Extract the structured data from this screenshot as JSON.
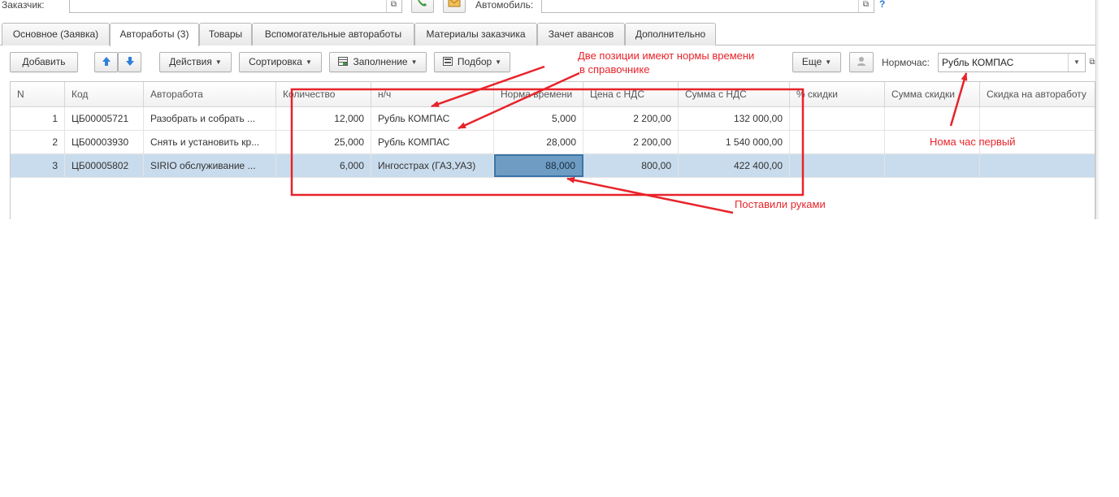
{
  "header": {
    "customer_label": "Заказчик:",
    "customer_value": "",
    "car_label": "Автомобиль:",
    "car_value": "",
    "open_icon": "open-external-icon",
    "phone_icon": "phone-icon",
    "mail_icon": "mail-icon",
    "help_label": "?"
  },
  "tabs": [
    {
      "label": "Основное (Заявка)"
    },
    {
      "label": "Автоработы (3)",
      "active": true
    },
    {
      "label": "Товары"
    },
    {
      "label": "Вспомогательные автоработы"
    },
    {
      "label": "Материалы заказчика"
    },
    {
      "label": "Зачет авансов"
    },
    {
      "label": "Дополнительно"
    }
  ],
  "toolbar": {
    "add_label": "Добавить",
    "up_icon": "arrow-up-icon",
    "down_icon": "arrow-down-icon",
    "actions_label": "Действия",
    "sort_label": "Сортировка",
    "fill_label": "Заполнение",
    "pick_label": "Подбор",
    "more_label": "Еще",
    "user_icon": "user-icon",
    "norm_label": "Нормочас:",
    "norm_value": "Рубль КОМПАС"
  },
  "table": {
    "columns": [
      "N",
      "Код",
      "Авторабота",
      "Количество",
      "н/ч",
      "Норма времени",
      "Цена с НДС",
      "Сумма с НДС",
      "% скидки",
      "Сумма скидки",
      "Скидка на автоработу"
    ],
    "rows": [
      {
        "n": "1",
        "code": "ЦБ00005721",
        "work": "Разобрать и собрать ...",
        "qty": "12,000",
        "nh": "Рубль КОМПАС",
        "norm": "5,000",
        "price": "2 200,00",
        "sum": "132 000,00",
        "disc_pct": "",
        "disc_sum": "",
        "disc_work": ""
      },
      {
        "n": "2",
        "code": "ЦБ00003930",
        "work": "Снять и установить кр...",
        "qty": "25,000",
        "nh": "Рубль КОМПАС",
        "norm": "28,000",
        "price": "2 200,00",
        "sum": "1 540 000,00",
        "disc_pct": "",
        "disc_sum": "",
        "disc_work": ""
      },
      {
        "n": "3",
        "code": "ЦБ00005802",
        "work": "SIRIO обслуживание ...",
        "qty": "6,000",
        "nh": "Ингосстрах (ГАЗ,УАЗ)",
        "norm": "88,000",
        "price": "800,00",
        "sum": "422 400,00",
        "disc_pct": "",
        "disc_sum": "",
        "disc_work": ""
      }
    ]
  },
  "annotations": {
    "note1_line1": "Две позиции имеют нормы времени",
    "note1_line2": "в справочнике",
    "note2": "Нома час первый",
    "note3": "Поставили руками",
    "color": "#e8232a"
  },
  "colors": {
    "selected_row": "#c9dced",
    "current_cell": "#6e9cc2"
  }
}
